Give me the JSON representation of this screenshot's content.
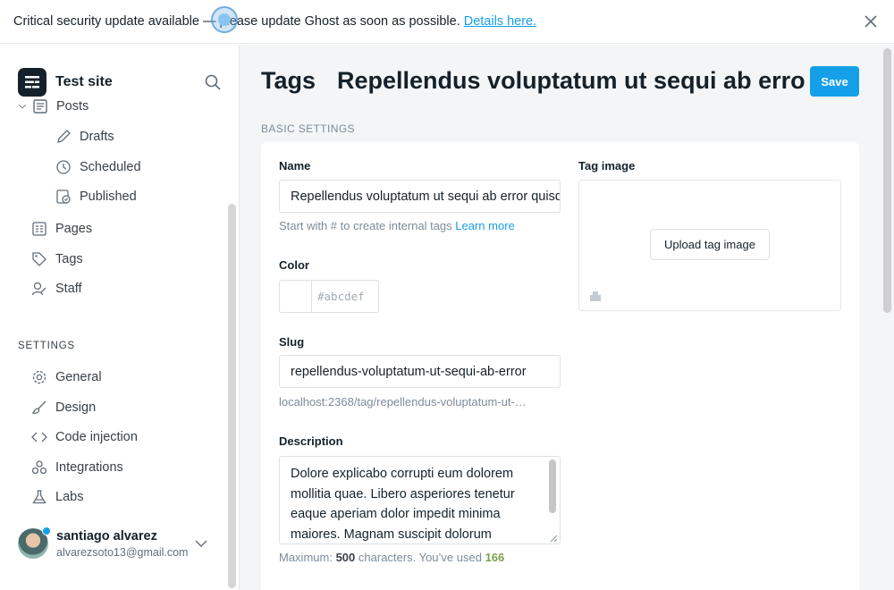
{
  "banner": {
    "text": "Critical security update available — please update Ghost as soon as possible.",
    "link": "Details here."
  },
  "sidebar": {
    "site_name": "Test site",
    "nav": {
      "posts": "Posts",
      "drafts": "Drafts",
      "scheduled": "Scheduled",
      "published": "Published",
      "pages": "Pages",
      "tags": "Tags",
      "staff": "Staff"
    },
    "settings_heading": "SETTINGS",
    "settings": {
      "general": "General",
      "design": "Design",
      "code_injection": "Code injection",
      "integrations": "Integrations",
      "labs": "Labs"
    },
    "user": {
      "name": "santiago alvarez",
      "email": "alvarezsoto13@gmail.com"
    }
  },
  "main": {
    "breadcrumb_parent": "Tags",
    "title": "Repellendus voluptatum ut sequi ab error",
    "save_label": "Save",
    "section_title": "BASIC SETTINGS",
    "name_label": "Name",
    "name_value": "Repellendus voluptatum ut sequi ab error quisquam",
    "name_hint": "Start with # to create internal tags",
    "name_hint_link": "Learn more",
    "color_label": "Color",
    "color_placeholder": "#abcdef",
    "slug_label": "Slug",
    "slug_value": "repellendus-voluptatum-ut-sequi-ab-error",
    "slug_url": "localhost:2368/tag/repellendus-voluptatum-ut-…",
    "description_label": "Description",
    "description_value": "Dolore explicabo corrupti eum dolorem mollitia quae. Libero asperiores tenetur eaque aperiam dolor impedit minima maiores. Magnam suscipit dolorum",
    "desc_count_prefix": "Maximum:",
    "desc_max": "500",
    "desc_count_mid": "characters. You’ve used",
    "desc_used": "166",
    "tag_image_label": "Tag image",
    "upload_label": "Upload tag image"
  },
  "colors": {
    "accent": "#14a0e8",
    "used_count": "#7aa14a"
  }
}
